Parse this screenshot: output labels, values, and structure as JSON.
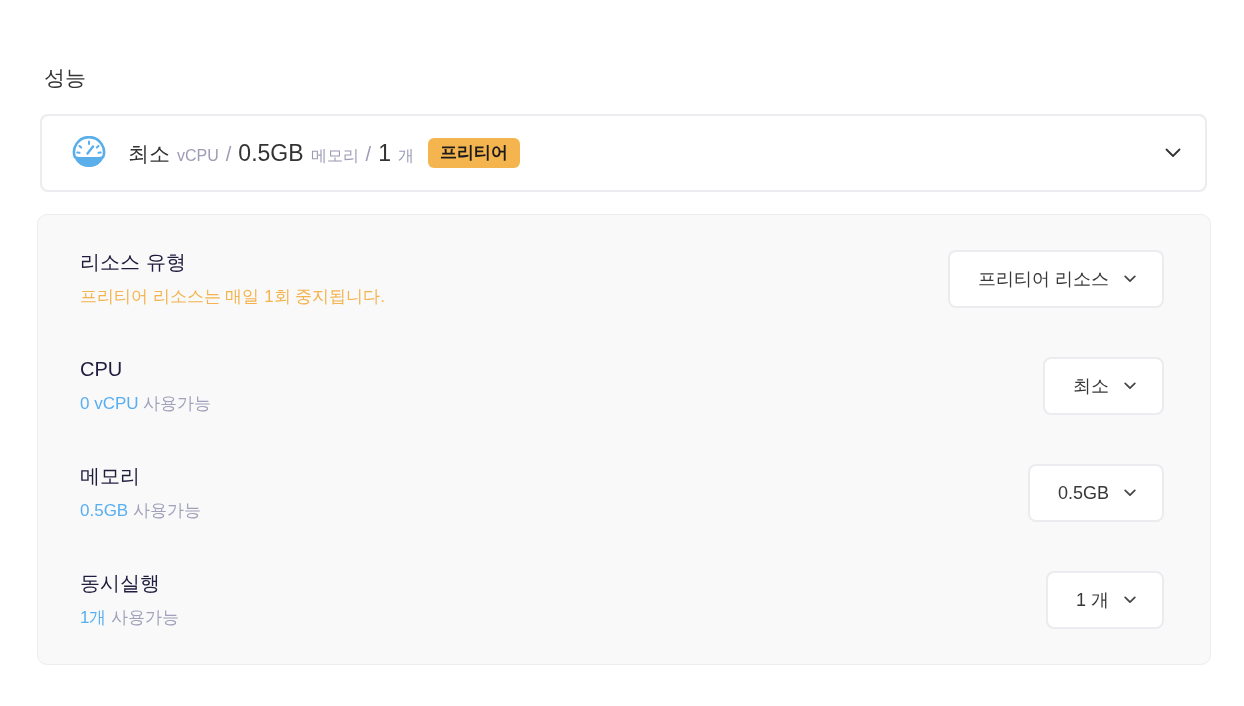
{
  "section": {
    "title": "성능"
  },
  "summary": {
    "expanded": true,
    "parts": [
      {
        "kind": "value",
        "text": "최소"
      },
      {
        "kind": "unit",
        "text": "vCPU"
      },
      {
        "kind": "separator",
        "text": "/"
      },
      {
        "kind": "value",
        "text": "0.5GB"
      },
      {
        "kind": "unit",
        "text": "메모리"
      },
      {
        "kind": "separator",
        "text": "/"
      },
      {
        "kind": "value",
        "text": "1"
      },
      {
        "kind": "unit",
        "text": "개"
      }
    ],
    "badge": "프리티어"
  },
  "settings": [
    {
      "label": "리소스 유형",
      "kind": "note",
      "note": "프리티어 리소스는 매일 1회 중지됩니다.",
      "value": "프리티어 리소스"
    },
    {
      "label": "CPU",
      "kind": "availability",
      "amount": "0 vCPU",
      "note": "사용가능",
      "value": "최소"
    },
    {
      "label": "메모리",
      "kind": "availability",
      "amount": "0.5GB",
      "note": "사용가능",
      "value": "0.5GB"
    },
    {
      "label": "동시실행",
      "kind": "availability",
      "amount": "1개",
      "note": "사용가능",
      "value": "1 개"
    }
  ]
}
